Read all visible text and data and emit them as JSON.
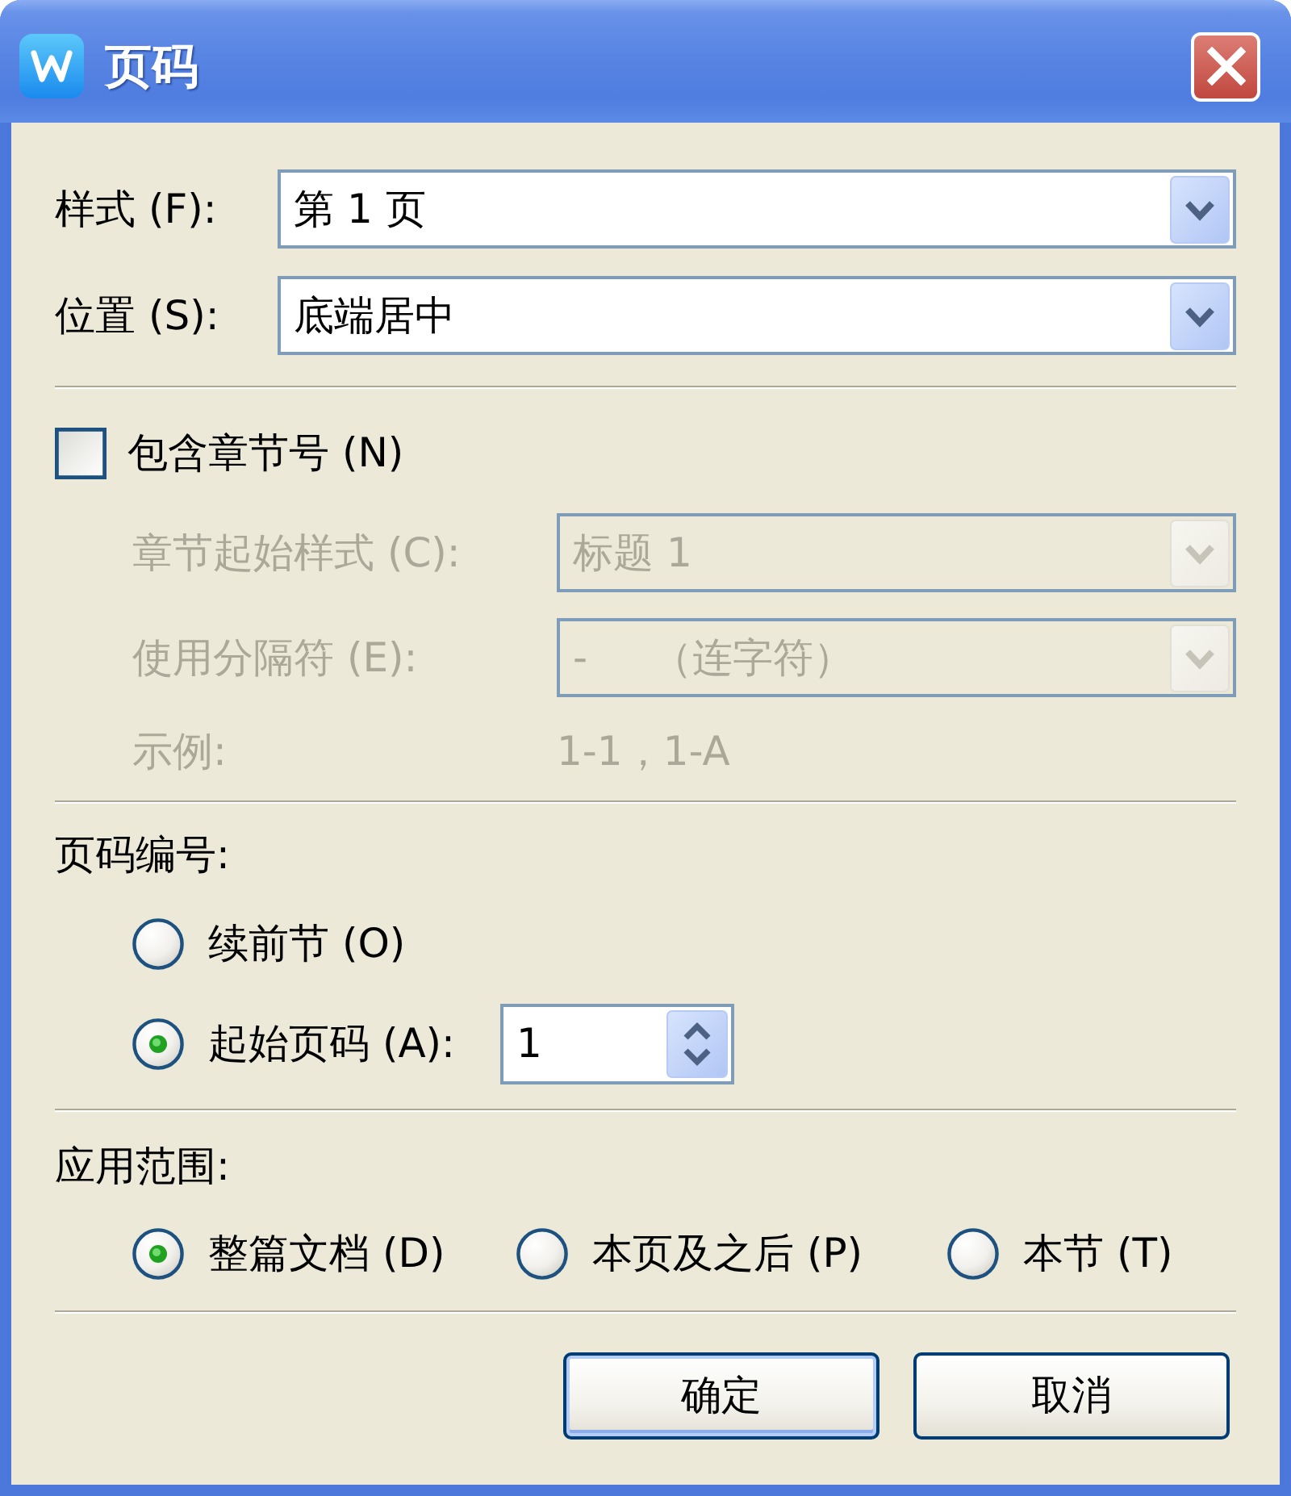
{
  "window": {
    "title": "页码"
  },
  "format_fields": [
    {
      "label": "样式 (F):",
      "value": "第 1 页"
    },
    {
      "label": "位置 (S):",
      "value": "底端居中"
    }
  ],
  "chapter": {
    "checkbox": {
      "label": "包含章节号 (N)",
      "checked": false
    },
    "fields": [
      {
        "label": "章节起始样式 (C):",
        "value": "标题 1",
        "disabled": true
      },
      {
        "label": "使用分隔符 (E):",
        "value": "-     （连字符）",
        "disabled": true
      }
    ],
    "example": {
      "label": "示例:",
      "value": "1-1，1-A",
      "disabled": true
    }
  },
  "numbering": {
    "heading": "页码编号:",
    "options": [
      {
        "kind": "radio",
        "label": "续前节 (O)",
        "selected": false
      },
      {
        "kind": "radio_with_number",
        "label": "起始页码 (A):",
        "selected": true,
        "value": "1"
      }
    ]
  },
  "scope": {
    "heading": "应用范围:",
    "options": [
      {
        "label": "整篇文档 (D)",
        "selected": true
      },
      {
        "label": "本页及之后 (P)",
        "selected": false
      },
      {
        "label": "本节 (T)",
        "selected": false
      }
    ]
  },
  "buttons": [
    {
      "label": "确定",
      "default": true
    },
    {
      "label": "取消",
      "default": false
    }
  ]
}
